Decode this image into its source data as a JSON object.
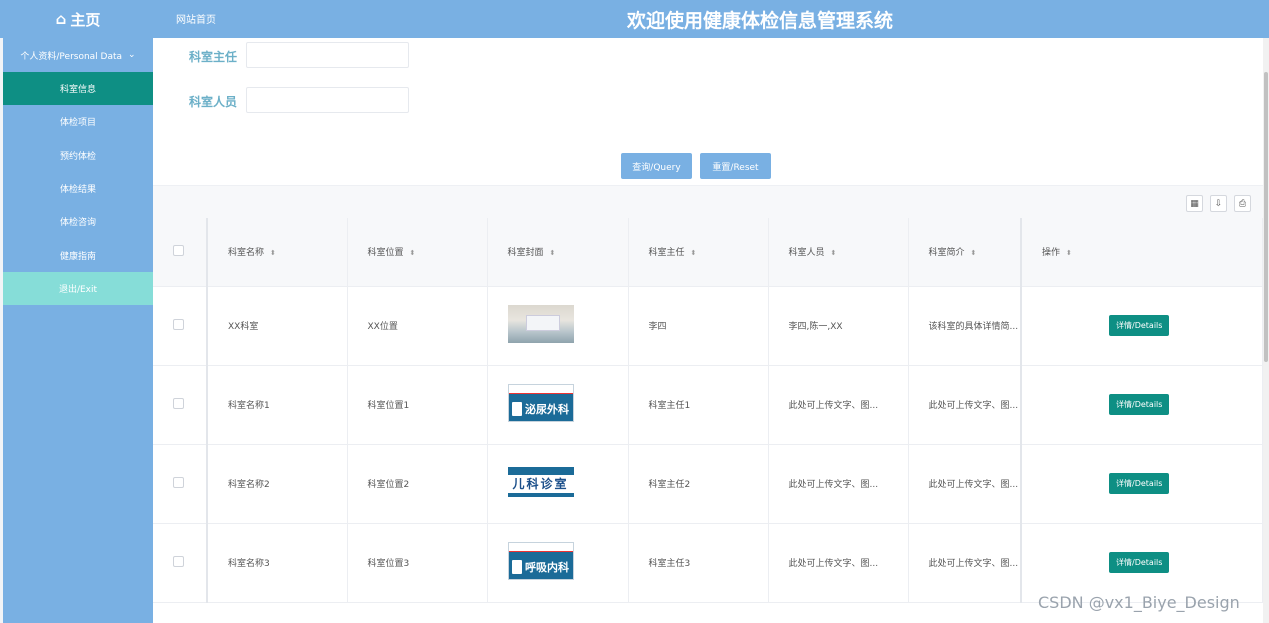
{
  "topbar": {
    "logo_label": "主页",
    "breadcrumb": "网站首页",
    "system_title": "欢迎使用健康体检信息管理系统"
  },
  "sidebar": {
    "group_label": "个人资料/Personal Data",
    "items": [
      {
        "label": "科室信息",
        "active": true
      },
      {
        "label": "体检项目"
      },
      {
        "label": "预约体检"
      },
      {
        "label": "体检结果"
      },
      {
        "label": "体检咨询"
      },
      {
        "label": "健康指南"
      },
      {
        "label": "退出/Exit"
      }
    ]
  },
  "search": {
    "director_label": "科室主任",
    "director_value": "",
    "staff_label": "科室人员",
    "staff_value": "",
    "query_button": "查询/Query",
    "reset_button": "重置/Reset"
  },
  "table": {
    "columns": [
      "科室名称",
      "科室位置",
      "科室封面",
      "科室主任",
      "科室人员",
      "科室简介",
      "操作"
    ],
    "detail_label": "详情/Details",
    "rows": [
      {
        "name": "XX科室",
        "location": "XX位置",
        "cover": "photo",
        "director": "李四",
        "staff": "李四,陈一,XX",
        "intro": "该科室的具体详情简..."
      },
      {
        "name": "科室名称1",
        "location": "科室位置1",
        "cover": "泌尿外科",
        "director": "科室主任1",
        "staff": "此处可上传文字、图...",
        "intro": "此处可上传文字、图..."
      },
      {
        "name": "科室名称2",
        "location": "科室位置2",
        "cover": "儿科诊室",
        "director": "科室主任2",
        "staff": "此处可上传文字、图...",
        "intro": "此处可上传文字、图..."
      },
      {
        "name": "科室名称3",
        "location": "科室位置3",
        "cover": "呼吸内科",
        "director": "科室主任3",
        "staff": "此处可上传文字、图...",
        "intro": "此处可上传文字、图..."
      }
    ]
  },
  "watermark": "CSDN @vx1_Biye_Design",
  "colors": {
    "primary": "#79b0e3",
    "active": "#0e8f84",
    "exit": "#86ddd8"
  }
}
